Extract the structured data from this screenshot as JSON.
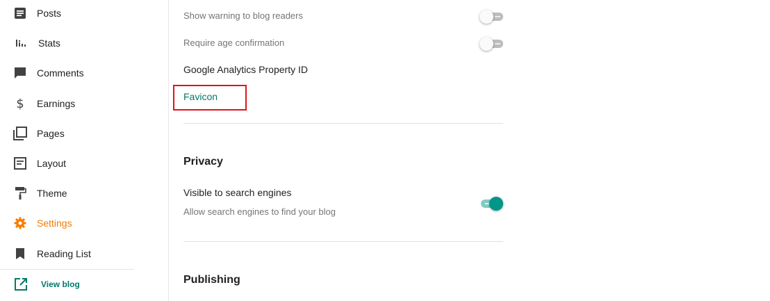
{
  "sidebar": {
    "items": [
      {
        "label": "Posts",
        "icon": "posts-icon"
      },
      {
        "label": "Stats",
        "icon": "stats-icon"
      },
      {
        "label": "Comments",
        "icon": "comments-icon"
      },
      {
        "label": "Earnings",
        "icon": "dollar-icon"
      },
      {
        "label": "Pages",
        "icon": "pages-icon"
      },
      {
        "label": "Layout",
        "icon": "layout-icon"
      },
      {
        "label": "Theme",
        "icon": "paint-roller-icon"
      },
      {
        "label": "Settings",
        "icon": "gear-icon"
      },
      {
        "label": "Reading List",
        "icon": "bookmark-icon"
      }
    ],
    "active": "Settings",
    "view_blog": "View blog"
  },
  "settings": {
    "show_warning": {
      "label": "Show warning to blog readers",
      "enabled": false
    },
    "age_confirmation": {
      "label": "Require age confirmation",
      "enabled": false
    },
    "analytics_label": "Google Analytics Property ID",
    "favicon_label": "Favicon",
    "privacy": {
      "title": "Privacy",
      "visible_label": "Visible to search engines",
      "visible_desc": "Allow search engines to find your blog",
      "visible_enabled": true
    },
    "publishing": {
      "title": "Publishing"
    }
  },
  "colors": {
    "accent_active": "#f57c00",
    "teal": "#00796b",
    "toggle_on": "#009688",
    "highlight": "#e0131a"
  }
}
